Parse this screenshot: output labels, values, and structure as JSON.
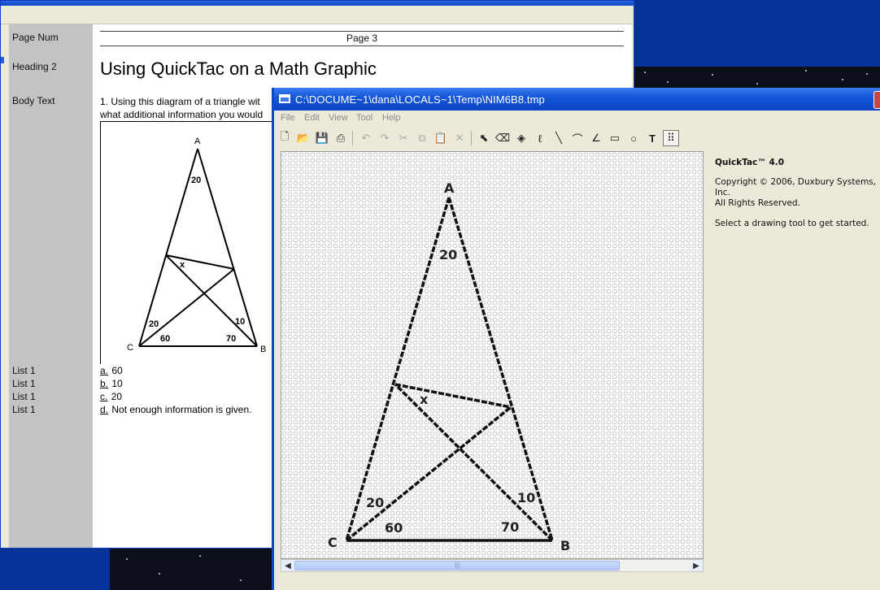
{
  "document": {
    "styles": [
      {
        "label": "Page Num"
      },
      {
        "label": "Heading 2"
      },
      {
        "label": "Body Text"
      },
      {
        "label": "List 1"
      },
      {
        "label": "List 1"
      },
      {
        "label": "List 1"
      },
      {
        "label": "List 1"
      }
    ],
    "page_number": "Page 3",
    "heading": "Using QuickTac on a Math Graphic",
    "body_line1": "1. Using this diagram of a triangle wit",
    "body_line2": "what additional information you would",
    "answers": [
      {
        "letter": "a.",
        "text": "60"
      },
      {
        "letter": "b.",
        "text": "10"
      },
      {
        "letter": "c.",
        "text": "20"
      },
      {
        "letter": "d.",
        "text": "Not enough information is given."
      }
    ],
    "diagram": {
      "vertex_a": "A",
      "vertex_b": "B",
      "vertex_c": "C",
      "angle_top": "20",
      "angle_x": "x",
      "angle_c1": "20",
      "angle_c2": "60",
      "angle_b1": "10",
      "angle_b2": "70"
    }
  },
  "quicktac": {
    "title": "C:\\DOCUME~1\\dana\\LOCALS~1\\Temp\\NIM6B8.tmp",
    "menu": [
      "File",
      "Edit",
      "View",
      "Tool",
      "Help"
    ],
    "toolbar_icons": [
      "new-icon",
      "open-icon",
      "save-icon",
      "print-icon",
      "undo-icon",
      "redo-icon",
      "cut-icon",
      "copy-icon",
      "paste-icon",
      "delete-icon",
      "select-arrow-icon",
      "eraser-icon",
      "fill-icon",
      "freehand-icon",
      "line-icon",
      "arc-icon",
      "angle-icon",
      "rectangle-icon",
      "circle-icon",
      "text-icon",
      "braille-dots-icon"
    ],
    "info_title": "QuickTac™ 4.0",
    "copyright": "Copyright © 2006, Duxbury Systems, Inc.",
    "rights": "All Rights Reserved.",
    "hint": "Select a drawing tool to get started.",
    "canvas": {
      "label_a": "A",
      "label_b": "B",
      "label_c": "C",
      "angle_top": "20",
      "angle_x": "x",
      "angle_c1": "20",
      "angle_c2": "60",
      "angle_b1": "10",
      "angle_b2": "70"
    }
  },
  "colors": {
    "title_bar": "#1557d8",
    "desktop": "#063299",
    "style_column": "#c3c3c3"
  }
}
